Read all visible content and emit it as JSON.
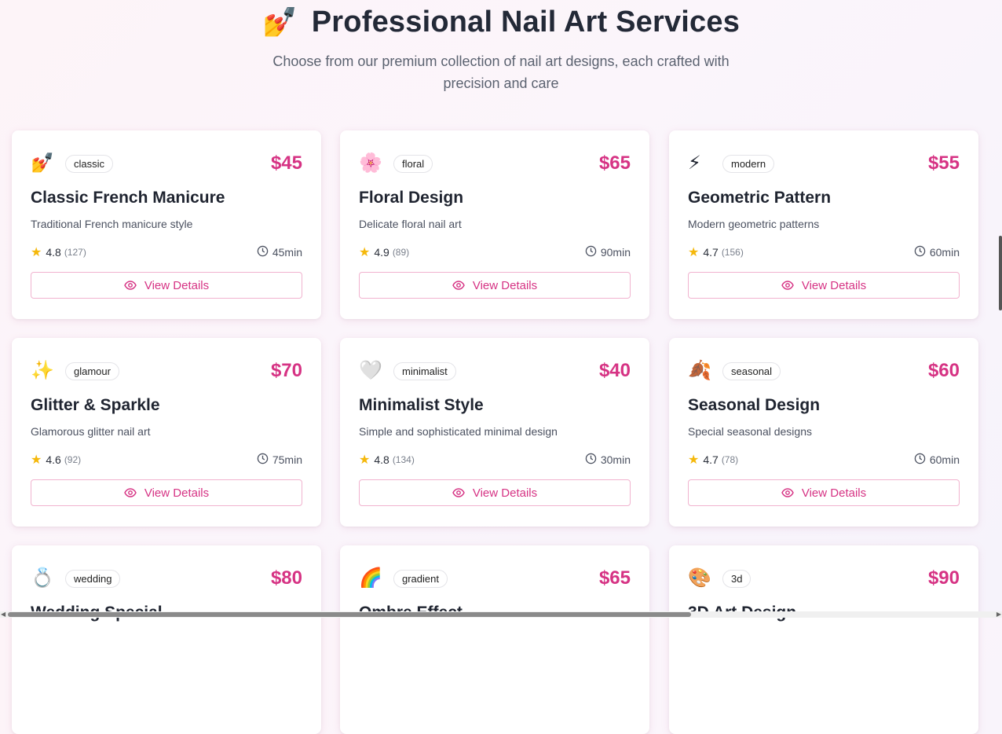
{
  "header": {
    "icon": "nail-polish-icon",
    "icon_glyph": "💅",
    "title": "Professional Nail Art Services",
    "subtitle": "Choose from our premium collection of nail art designs, each crafted with precision and care"
  },
  "accent_color": "#d63384",
  "services": [
    {
      "icon": "nail-polish-icon",
      "emoji": "💅",
      "tag": "classic",
      "price": "$45",
      "name": "Classic French Manicure",
      "desc": "Traditional French manicure style",
      "rating": "4.8",
      "reviews": "(127)",
      "duration": "45min",
      "button": "View Details"
    },
    {
      "icon": "flower-icon",
      "emoji": "🌸",
      "tag": "floral",
      "price": "$65",
      "name": "Floral Design",
      "desc": "Delicate floral nail art",
      "rating": "4.9",
      "reviews": "(89)",
      "duration": "90min",
      "button": "View Details"
    },
    {
      "icon": "lightning-icon",
      "emoji": "⚡",
      "tag": "modern",
      "price": "$55",
      "name": "Geometric Pattern",
      "desc": "Modern geometric patterns",
      "rating": "4.7",
      "reviews": "(156)",
      "duration": "60min",
      "button": "View Details"
    },
    {
      "icon": "sparkles-icon",
      "emoji": "✨",
      "tag": "glamour",
      "price": "$70",
      "name": "Glitter & Sparkle",
      "desc": "Glamorous glitter nail art",
      "rating": "4.6",
      "reviews": "(92)",
      "duration": "75min",
      "button": "View Details"
    },
    {
      "icon": "heart-icon",
      "emoji": "🤍",
      "tag": "minimalist",
      "price": "$40",
      "name": "Minimalist Style",
      "desc": "Simple and sophisticated minimal design",
      "rating": "4.8",
      "reviews": "(134)",
      "duration": "30min",
      "button": "View Details"
    },
    {
      "icon": "leaves-icon",
      "emoji": "🍂",
      "tag": "seasonal",
      "price": "$60",
      "name": "Seasonal Design",
      "desc": "Special seasonal designs",
      "rating": "4.7",
      "reviews": "(78)",
      "duration": "60min",
      "button": "View Details"
    },
    {
      "icon": "ring-icon",
      "emoji": "💍",
      "tag": "wedding",
      "price": "$80",
      "name": "Wedding Special",
      "desc": "",
      "rating": "",
      "reviews": "",
      "duration": "",
      "button": ""
    },
    {
      "icon": "rainbow-icon",
      "emoji": "🌈",
      "tag": "gradient",
      "price": "$65",
      "name": "Ombre Effect",
      "desc": "",
      "rating": "",
      "reviews": "",
      "duration": "",
      "button": ""
    },
    {
      "icon": "palette-icon",
      "emoji": "🎨",
      "tag": "3d",
      "price": "$90",
      "name": "3D Art Design",
      "desc": "",
      "rating": "",
      "reviews": "",
      "duration": "",
      "button": ""
    }
  ]
}
